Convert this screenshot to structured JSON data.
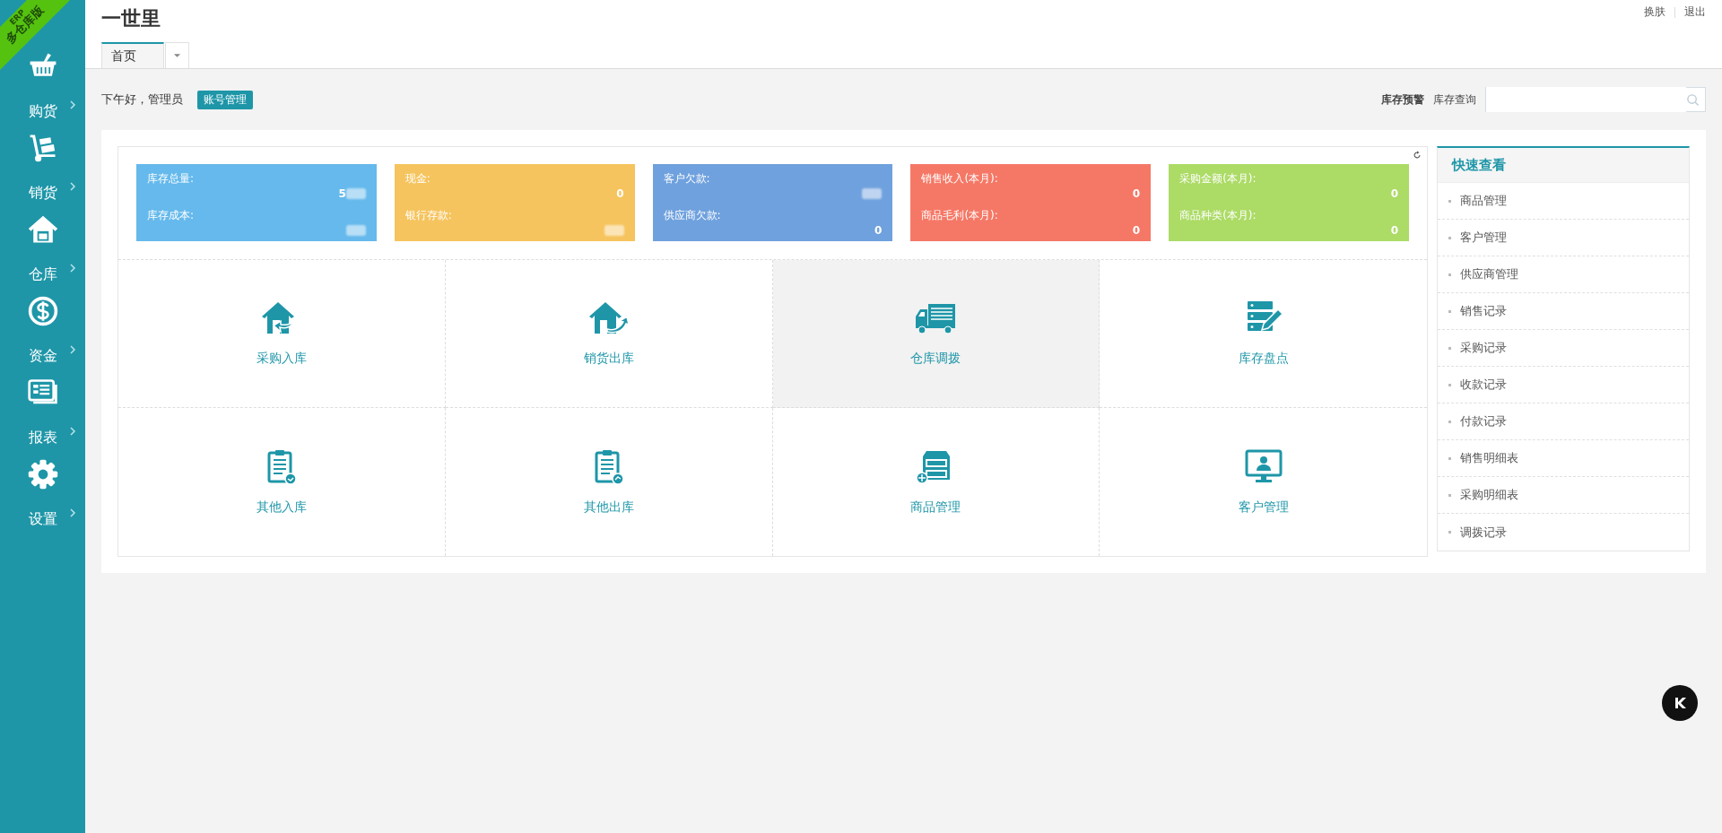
{
  "ribbon": {
    "top": "ERP",
    "bottom": "多仓库版"
  },
  "sidebar": {
    "items": [
      {
        "label": "购货",
        "kind": "basket"
      },
      {
        "label": "销货",
        "kind": "cart"
      },
      {
        "label": "仓库",
        "kind": "house"
      },
      {
        "label": "资金",
        "kind": "dollar"
      },
      {
        "label": "报表",
        "kind": "report"
      },
      {
        "label": "设置",
        "kind": "gear"
      }
    ]
  },
  "header": {
    "title": "一世里",
    "links": [
      "换肤",
      "退出"
    ]
  },
  "tabs": [
    {
      "label": "首页",
      "selected": true
    }
  ],
  "greeting": {
    "text": "下午好，管理员",
    "button": "账号管理"
  },
  "toolbar": {
    "links": [
      {
        "label": "库存预警",
        "bold": true
      },
      {
        "label": "库存查询",
        "bold": false
      }
    ]
  },
  "cards": [
    {
      "color": "#65b9ec",
      "rows": [
        {
          "label": "库存总量:",
          "value": "5",
          "blurred": true
        },
        {
          "label": "库存成本:",
          "blurred": true
        }
      ]
    },
    {
      "color": "#f6c45e",
      "rows": [
        {
          "label": "现金:",
          "value": "0"
        },
        {
          "label": "银行存款:",
          "blurred": true
        }
      ]
    },
    {
      "color": "#6fa1de",
      "rows": [
        {
          "label": "客户欠款:",
          "blurred": true
        },
        {
          "label": "供应商欠款:",
          "value": "0"
        }
      ]
    },
    {
      "color": "#f57866",
      "rows": [
        {
          "label": "销售收入(本月):",
          "value": "0"
        },
        {
          "label": "商品毛利(本月):",
          "value": "0"
        }
      ]
    },
    {
      "color": "#acdb66",
      "rows": [
        {
          "label": "采购金额(本月):",
          "value": "0"
        },
        {
          "label": "商品种类(本月):",
          "value": "0"
        }
      ]
    }
  ],
  "tiles": [
    {
      "label": "采购入库",
      "kind": "house-in",
      "highlighted": false
    },
    {
      "label": "销货出库",
      "kind": "house-out",
      "highlighted": false
    },
    {
      "label": "仓库调拨",
      "kind": "truck",
      "highlighted": true
    },
    {
      "label": "库存盘点",
      "kind": "server-pencil",
      "highlighted": false
    },
    {
      "label": "其他入库",
      "kind": "clipboard-in",
      "highlighted": false
    },
    {
      "label": "其他出库",
      "kind": "clipboard-out",
      "highlighted": false
    },
    {
      "label": "商品管理",
      "kind": "cabinet",
      "highlighted": false
    },
    {
      "label": "客户管理",
      "kind": "monitor",
      "highlighted": false
    }
  ],
  "quick_view": {
    "title": "快速查看",
    "items": [
      "商品管理",
      "客户管理",
      "供应商管理",
      "销售记录",
      "采购记录",
      "收款记录",
      "付款记录",
      "销售明细表",
      "采购明细表",
      "调拨记录"
    ]
  }
}
